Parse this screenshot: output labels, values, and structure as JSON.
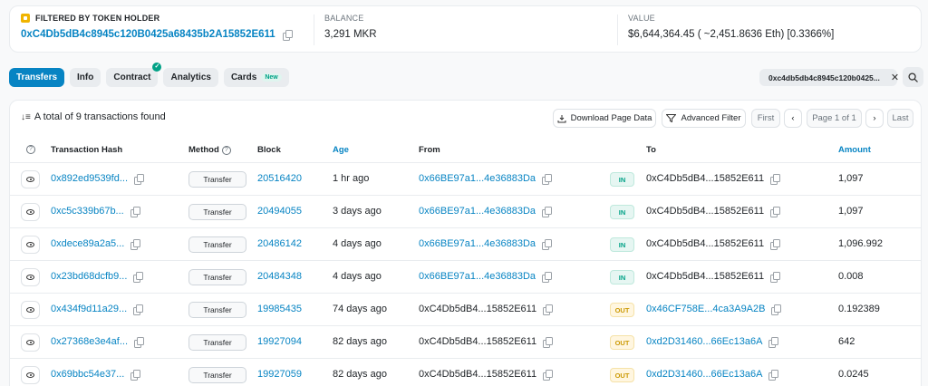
{
  "filter": {
    "holder_label": "FILTERED BY TOKEN HOLDER",
    "holder_address": "0xC4Db5dB4c8945c120B0425a68435b2A15852E611",
    "balance_label": "BALANCE",
    "balance_value": "3,291 MKR",
    "value_label": "VALUE",
    "value_value": "$6,644,364.45 ( ~2,451.8636 Eth) [0.3366%]"
  },
  "tabs": [
    {
      "label": "Transfers",
      "active": true
    },
    {
      "label": "Info"
    },
    {
      "label": "Contract"
    },
    {
      "label": "Analytics"
    },
    {
      "label": "Cards",
      "badge": "New"
    }
  ],
  "address_filter": "0xc4db5db4c8945c120b0425...",
  "toolbar": {
    "total_text": "A total of 9 transactions found",
    "download_label": "Download Page Data",
    "advanced_filter_label": "Advanced Filter",
    "first_label": "First",
    "page_label": "Page 1 of 1",
    "last_label": "Last"
  },
  "columns": {
    "hash": "Transaction Hash",
    "method": "Method",
    "block": "Block",
    "age": "Age",
    "from": "From",
    "to": "To",
    "amount": "Amount"
  },
  "rows": [
    {
      "hash": "0x892ed9539fd...",
      "method": "Transfer",
      "block": "20516420",
      "age": "1 hr ago",
      "from": "0x66BE97a1...4e36883Da",
      "from_link": true,
      "dir": "IN",
      "to": "0xC4Db5dB4...15852E611",
      "to_link": false,
      "amount": "1,097"
    },
    {
      "hash": "0xc5c339b67b...",
      "method": "Transfer",
      "block": "20494055",
      "age": "3 days ago",
      "from": "0x66BE97a1...4e36883Da",
      "from_link": true,
      "dir": "IN",
      "to": "0xC4Db5dB4...15852E611",
      "to_link": false,
      "amount": "1,097"
    },
    {
      "hash": "0xdece89a2a5...",
      "method": "Transfer",
      "block": "20486142",
      "age": "4 days ago",
      "from": "0x66BE97a1...4e36883Da",
      "from_link": true,
      "dir": "IN",
      "to": "0xC4Db5dB4...15852E611",
      "to_link": false,
      "amount": "1,096.992"
    },
    {
      "hash": "0x23bd68dcfb9...",
      "method": "Transfer",
      "block": "20484348",
      "age": "4 days ago",
      "from": "0x66BE97a1...4e36883Da",
      "from_link": true,
      "dir": "IN",
      "to": "0xC4Db5dB4...15852E611",
      "to_link": false,
      "amount": "0.008"
    },
    {
      "hash": "0x434f9d11a29...",
      "method": "Transfer",
      "block": "19985435",
      "age": "74 days ago",
      "from": "0xC4Db5dB4...15852E611",
      "from_link": false,
      "dir": "OUT",
      "to": "0x46CF758E...4ca3A9A2B",
      "to_link": true,
      "amount": "0.192389"
    },
    {
      "hash": "0x27368e3e4af...",
      "method": "Transfer",
      "block": "19927094",
      "age": "82 days ago",
      "from": "0xC4Db5dB4...15852E611",
      "from_link": false,
      "dir": "OUT",
      "to": "0xd2D31460...66Ec13a6A",
      "to_link": true,
      "amount": "642"
    },
    {
      "hash": "0x69bbc54e37...",
      "method": "Transfer",
      "block": "19927059",
      "age": "82 days ago",
      "from": "0xC4Db5dB4...15852E611",
      "from_link": false,
      "dir": "OUT",
      "to": "0xd2D31460...66Ec13a6A",
      "to_link": true,
      "amount": "0.0245"
    }
  ],
  "colors": {
    "link": "#0784c3",
    "in": "#00a186",
    "out": "#cc9a06"
  }
}
